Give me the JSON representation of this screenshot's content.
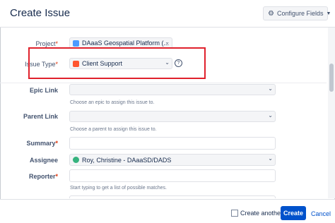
{
  "dialog": {
    "title": "Create Issue",
    "configure_label": "Configure Fields",
    "configure_icon": "gear-icon"
  },
  "form": {
    "project": {
      "label": "Project",
      "value": "DAaaS Geospatial Platform (...",
      "icon": "project-icon"
    },
    "issue_type": {
      "label": "Issue Type",
      "value": "Client Support",
      "icon": "client-support-icon"
    },
    "epic_link": {
      "label": "Epic Link",
      "value": "",
      "help": "Choose an epic to assign this issue to."
    },
    "parent_link": {
      "label": "Parent Link",
      "value": "",
      "help": "Choose a parent to assign this issue to."
    },
    "summary": {
      "label": "Summary",
      "value": ""
    },
    "assignee": {
      "label": "Assignee",
      "value": "Roy, Christine - DAaaSD/DADS",
      "icon": "user-avatar-icon"
    },
    "reporter": {
      "label": "Reporter",
      "value": "",
      "help": "Start typing to get a list of possible matches."
    }
  },
  "footer": {
    "create_another_label": "Create another",
    "create_label": "Create",
    "cancel_label": "Cancel"
  },
  "colors": {
    "primary": "#0052cc",
    "highlight_border": "#e0212c",
    "required": "#de350b"
  }
}
